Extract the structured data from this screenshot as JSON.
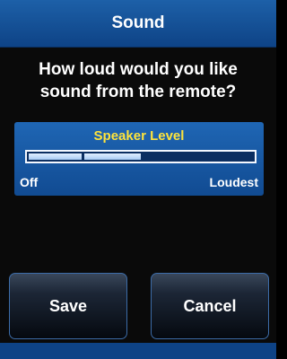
{
  "header": {
    "title": "Sound"
  },
  "prompt": {
    "question": "How loud would you like sound from the remote?"
  },
  "speaker_level": {
    "label": "Speaker Level",
    "min_label": "Off",
    "max_label": "Loudest",
    "level_fraction": 0.5
  },
  "actions": {
    "save_label": "Save",
    "cancel_label": "Cancel"
  },
  "colors": {
    "header_bg": "#1d60a8",
    "panel_bg": "#1f66b4",
    "level_label": "#ffe43b",
    "button_border": "#3c6ca8"
  }
}
